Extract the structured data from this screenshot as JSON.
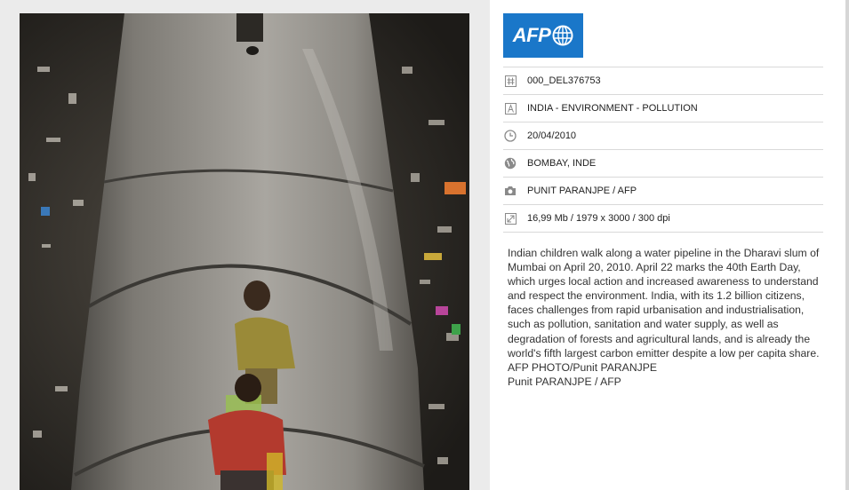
{
  "logo": {
    "text": "AFP"
  },
  "meta": {
    "reference": "000_DEL376753",
    "title": "INDIA - ENVIRONMENT - POLLUTION",
    "date": "20/04/2010",
    "location": "BOMBAY, INDE",
    "credit": "PUNIT PARANJPE / AFP",
    "file_info": "16,99 Mb / 1979 x 3000 / 300 dpi"
  },
  "caption": {
    "text": "Indian children walk along a water pipeline in the Dharavi slum of Mumbai on April 20, 2010. April 22 marks the 40th Earth Day, which urges local action and increased awareness to understand and respect the environment. India, with its 1.2 billion citizens, faces challenges from rapid urbanisation and industrialisation, such as pollution, sanitation and water supply, as well as degradation of forests and agricultural lands, and is already the world's fifth largest carbon emitter despite a low per capita share. AFP PHOTO/Punit PARANJPE",
    "byline": "Punit PARANJPE / AFP"
  },
  "icons": {
    "reference": "hash-icon",
    "title": "text-a-icon",
    "date": "clock-icon",
    "location": "globe-icon",
    "credit": "camera-icon",
    "file_info": "resize-icon"
  },
  "colors": {
    "brand": "#1a77c9",
    "divider": "#d9d9d9",
    "text": "#333333"
  }
}
